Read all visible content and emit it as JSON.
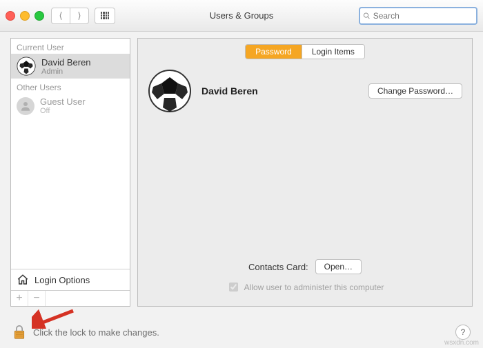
{
  "window": {
    "title": "Users & Groups"
  },
  "search": {
    "placeholder": "Search"
  },
  "sidebar": {
    "section_current": "Current User",
    "section_other": "Other Users",
    "current": {
      "name": "David Beren",
      "role": "Admin"
    },
    "guest": {
      "name": "Guest User",
      "status": "Off"
    },
    "login_options": "Login Options"
  },
  "tabs": {
    "password": "Password",
    "login_items": "Login Items"
  },
  "main": {
    "display_name": "David Beren",
    "change_password": "Change Password…",
    "contacts_label": "Contacts Card:",
    "open": "Open…",
    "admin_check": "Allow user to administer this computer",
    "admin_checked": true
  },
  "footer": {
    "lock_text": "Click the lock to make changes."
  },
  "watermark": "wsxdn.com"
}
